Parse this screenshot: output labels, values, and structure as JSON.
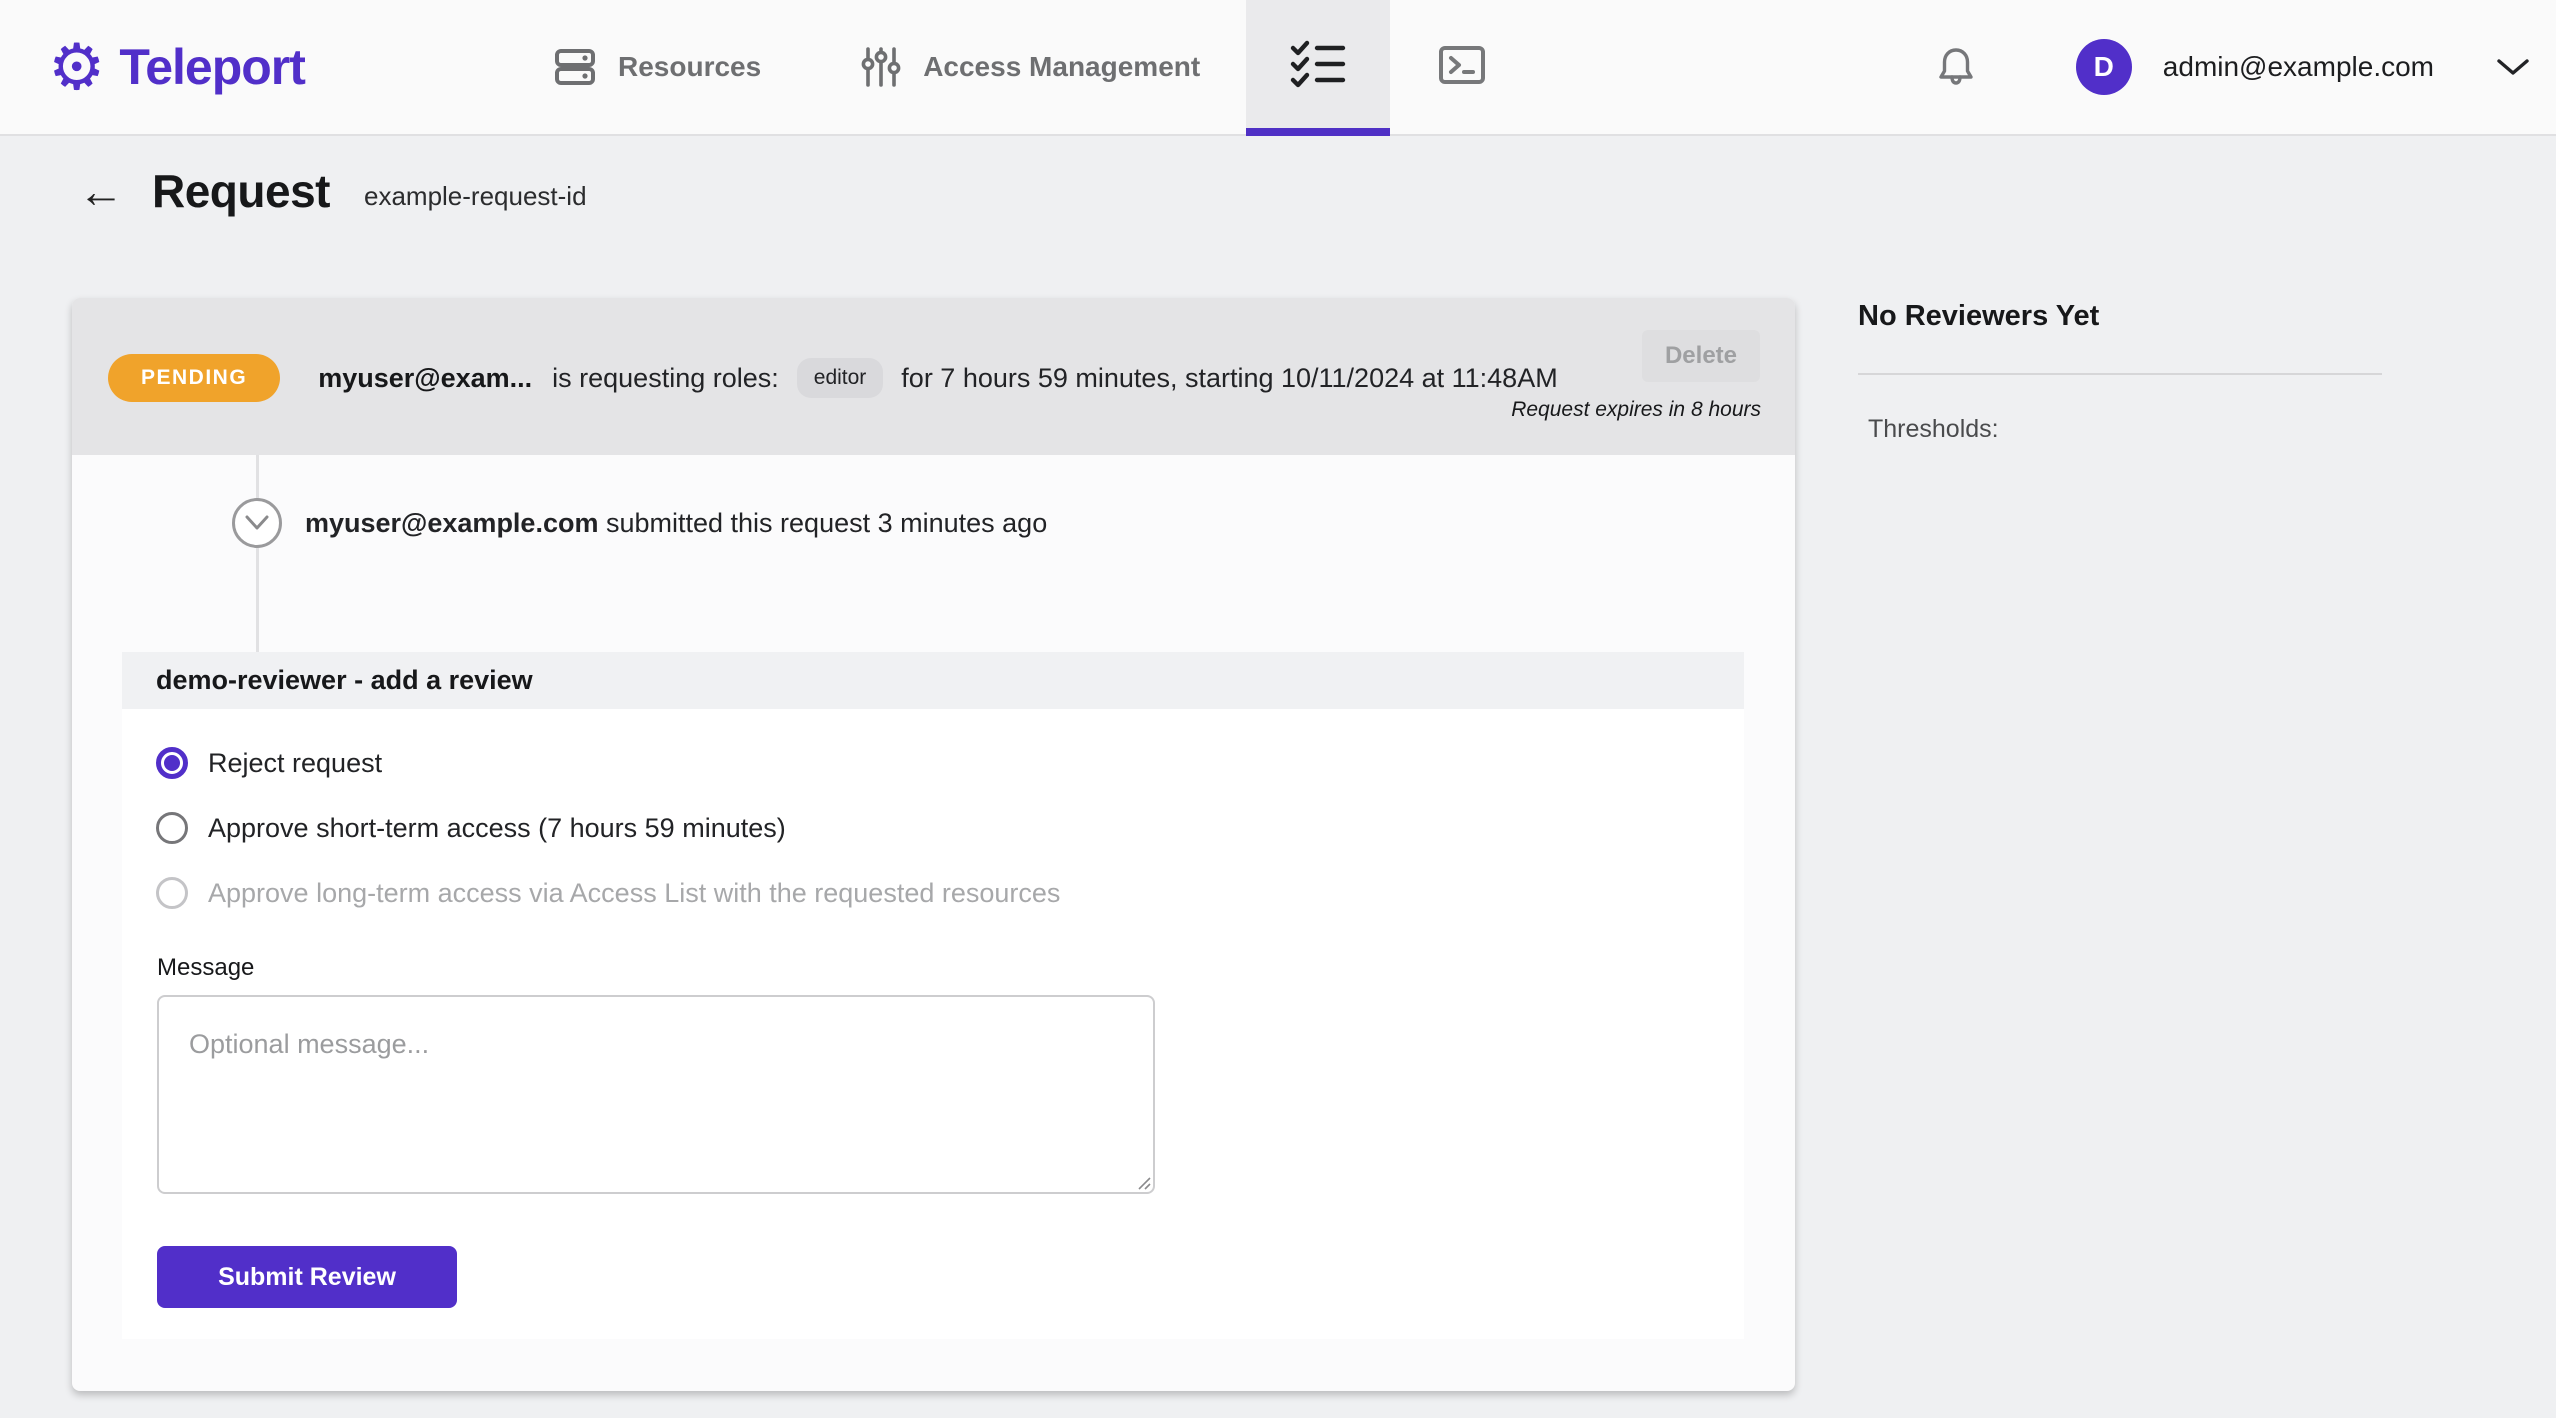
{
  "colors": {
    "accent": "#512FC9",
    "pending_badge": "#F0A32B"
  },
  "brand": {
    "name": "Teleport"
  },
  "nav": {
    "items": [
      {
        "label": "Resources"
      },
      {
        "label": "Access Management"
      }
    ],
    "account": {
      "avatar_initial": "D",
      "email": "admin@example.com"
    }
  },
  "page": {
    "title": "Request",
    "subtitle": "example-request-id",
    "back_arrow": "←"
  },
  "request": {
    "status": "PENDING",
    "requester": "myuser@exam...",
    "action_text": "is requesting roles:",
    "role": "editor",
    "duration_text": "for 7 hours 59 minutes, starting 10/11/2024 at 11:48AM",
    "delete_label": "Delete",
    "expires_text": "Request expires in 8 hours"
  },
  "timeline": {
    "event": {
      "user": "myuser@example.com",
      "text": " submitted this request 3 minutes ago"
    }
  },
  "review": {
    "header": "demo-reviewer - add a review",
    "options": [
      {
        "label": "Reject request"
      },
      {
        "label": "Approve short-term access (7 hours 59 minutes)"
      },
      {
        "label": "Approve long-term access via Access List with the requested resources"
      }
    ],
    "message_label": "Message",
    "message_placeholder": "Optional message...",
    "submit_label": "Submit Review"
  },
  "sidebar": {
    "heading": "No Reviewers Yet",
    "thresholds_label": "Thresholds:"
  },
  "logo_glyph": "⚙"
}
